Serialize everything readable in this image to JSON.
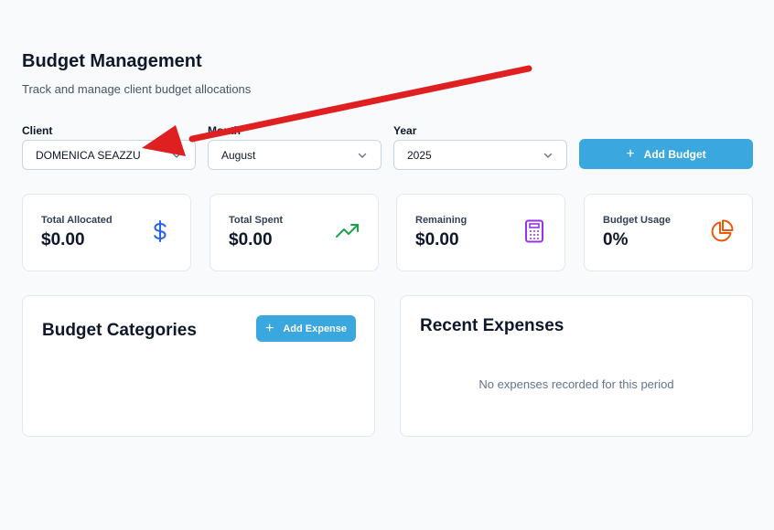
{
  "header": {
    "title": "Budget Management",
    "subtitle": "Track and manage client budget allocations"
  },
  "filters": {
    "client": {
      "label": "Client",
      "value": "DOMENICA SEAZZU"
    },
    "month": {
      "label": "Month",
      "value": "August"
    },
    "year": {
      "label": "Year",
      "value": "2025"
    },
    "add_budget_label": "Add Budget"
  },
  "stats": [
    {
      "label": "Total Allocated",
      "value": "$0.00",
      "icon": "dollar-icon",
      "color": "#2563eb"
    },
    {
      "label": "Total Spent",
      "value": "$0.00",
      "icon": "trending-up-icon",
      "color": "#16a34a"
    },
    {
      "label": "Remaining",
      "value": "$0.00",
      "icon": "calculator-icon",
      "color": "#9333ea"
    },
    {
      "label": "Budget Usage",
      "value": "0%",
      "icon": "pie-chart-icon",
      "color": "#ea580c"
    }
  ],
  "categories_panel": {
    "title": "Budget Categories",
    "add_expense_label": "Add Expense"
  },
  "expenses_panel": {
    "title": "Recent Expenses",
    "empty_text": "No expenses recorded for this period"
  },
  "colors": {
    "accent": "#3aa8de",
    "annotation_arrow": "#e02020"
  }
}
